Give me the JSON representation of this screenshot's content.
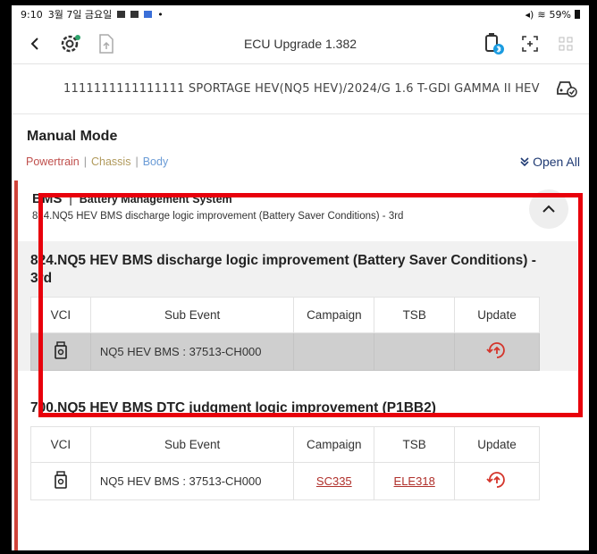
{
  "status_bar": {
    "time": "9:10",
    "date": "3월 7일 금요일",
    "battery": "59%"
  },
  "header": {
    "title": "ECU Upgrade 1.382"
  },
  "vehicle": {
    "description": "1111111111111111 SPORTAGE HEV(NQ5 HEV)/2024/G 1.6 T-GDI GAMMA II HEV"
  },
  "mode": {
    "title": "Manual Mode"
  },
  "filters": {
    "powertrain": "Powertrain",
    "separator": "|",
    "chassis": "Chassis",
    "body": "Body",
    "open_all": "Open All"
  },
  "system": {
    "code": "BMS",
    "separator": "|",
    "name": "Battery Management System",
    "subtitle": "824.NQ5 HEV BMS discharge logic improvement (Battery Saver Conditions) - 3rd"
  },
  "table_headers": {
    "vci": "VCI",
    "sub_event": "Sub Event",
    "campaign": "Campaign",
    "tsb": "TSB",
    "update": "Update"
  },
  "events": [
    {
      "title": "824.NQ5 HEV BMS discharge logic improvement (Battery Saver Conditions) - 3rd",
      "row": {
        "sub_event": "NQ5 HEV BMS : 37513-CH000",
        "campaign": "",
        "tsb": ""
      }
    },
    {
      "title": "700.NQ5 HEV BMS DTC judgment logic improvement (P1BB2)",
      "row": {
        "sub_event": "NQ5 HEV BMS  : 37513-CH000",
        "campaign": "SC335",
        "tsb": "ELE318"
      }
    }
  ],
  "colors": {
    "accent_red": "#e8000b",
    "powertrain": "#c0504d",
    "chassis": "#b19a5c",
    "body": "#6a9bd6",
    "link": "#b0302b",
    "open_all": "#1f3a73"
  },
  "icons": [
    "back-arrow-icon",
    "vehicle-gear-icon",
    "file-upload-icon",
    "vci-bluetooth-icon",
    "scan-icon",
    "grid-icon",
    "car-check-icon",
    "chevron-up-icon",
    "vci-device-icon",
    "update-icon"
  ]
}
